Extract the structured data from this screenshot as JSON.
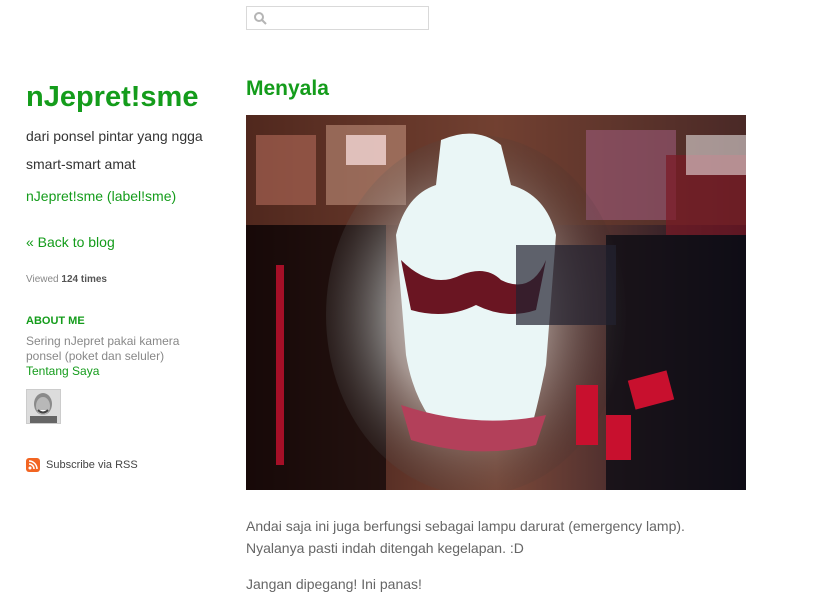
{
  "search": {
    "placeholder": ""
  },
  "sidebar": {
    "blog_title": "nJepret!sme",
    "blog_description": "dari ponsel pintar yang ngga smart-smart amat",
    "label_link": "nJepret!sme (label!sme)",
    "back_link": "« Back to blog",
    "viewed_prefix": "Viewed",
    "viewed_count": "124 times",
    "about_heading": "ABOUT ME",
    "about_text": "Sering nJepret pakai kamera ponsel (poket dan seluler)",
    "about_link": "Tentang Saya",
    "rss_label": "Subscribe via RSS"
  },
  "post": {
    "title": "Menyala",
    "paragraphs": [
      "Andai saja ini juga berfungsi sebagai lampu darurat (emergency lamp). Nyalanya pasti indah ditengah kegelapan. :D",
      "Jangan dipegang! Ini panas!"
    ]
  },
  "colors": {
    "accent": "#149c1b",
    "text": "#666666",
    "rss": "#f26522"
  },
  "icons": {
    "search": "search-icon",
    "rss": "rss-icon",
    "avatar": "avatar"
  }
}
